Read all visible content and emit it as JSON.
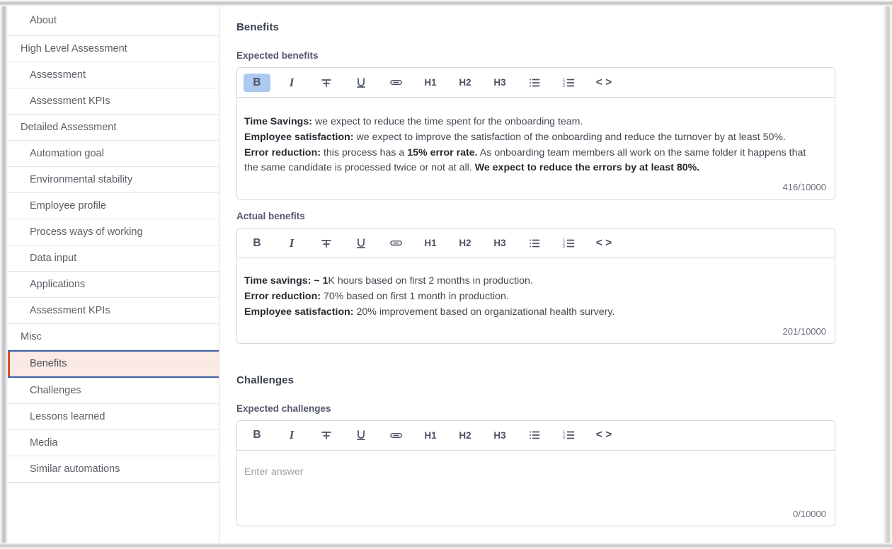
{
  "sidebar": {
    "items": [
      {
        "label": "About",
        "level": 1,
        "selected": false
      },
      {
        "label": "High Level Assessment",
        "level": 0,
        "selected": false
      },
      {
        "label": "Assessment",
        "level": 1,
        "selected": false
      },
      {
        "label": "Assessment KPIs",
        "level": 1,
        "selected": false
      },
      {
        "label": "Detailed Assessment",
        "level": 0,
        "selected": false
      },
      {
        "label": "Automation goal",
        "level": 1,
        "selected": false
      },
      {
        "label": "Environmental stability",
        "level": 1,
        "selected": false
      },
      {
        "label": "Employee profile",
        "level": 1,
        "selected": false
      },
      {
        "label": "Process ways of working",
        "level": 1,
        "selected": false
      },
      {
        "label": "Data input",
        "level": 1,
        "selected": false
      },
      {
        "label": "Applications",
        "level": 1,
        "selected": false
      },
      {
        "label": "Assessment KPIs",
        "level": 1,
        "selected": false
      },
      {
        "label": "Misc",
        "level": 0,
        "selected": false
      },
      {
        "label": "Benefits",
        "level": 1,
        "selected": true
      },
      {
        "label": "Challenges",
        "level": 1,
        "selected": false
      },
      {
        "label": "Lessons learned",
        "level": 1,
        "selected": false
      },
      {
        "label": "Media",
        "level": 1,
        "selected": false
      },
      {
        "label": "Similar automations",
        "level": 1,
        "selected": false
      }
    ]
  },
  "toolbar": {
    "bold": "B",
    "italic": "I",
    "strikethrough": "strikethrough-icon",
    "underline": "U",
    "link": "link-icon",
    "h1": "H1",
    "h2": "H2",
    "h3": "H3",
    "bullet_list": "bullet-list-icon",
    "numbered_list": "numbered-list-icon",
    "code": "< >"
  },
  "sections": {
    "benefits": {
      "title": "Benefits",
      "expected": {
        "label": "Expected benefits",
        "counter": "416/10000",
        "lines": [
          {
            "bold": "Time Savings:",
            "rest": " we expect to reduce the time spent for the onboarding team."
          },
          {
            "bold": "Employee satisfaction:",
            "rest": " we expect to improve the satisfaction of the onboarding and reduce the turnover by at least 50%."
          }
        ],
        "error_line": {
          "bold_lead": "Error reduction:",
          "part1": " this process has a ",
          "bold_mid": "15% error rate.",
          "part2": " As onboarding team members all work on the same folder it happens that the same candidate is processed twice or not at all. ",
          "bold_tail": "We expect to reduce the errors by at least 80%."
        }
      },
      "actual": {
        "label": "Actual benefits",
        "counter": "201/10000",
        "lines": [
          {
            "bold": "Time savings: ~ 1",
            "rest": "K hours based on first 2 months in production."
          },
          {
            "bold": "Error reduction:",
            "rest": " 70% based on first 1 month in production."
          },
          {
            "bold": "Employee satisfaction:",
            "rest": " 20% improvement based on organizational health survery."
          }
        ]
      }
    },
    "challenges": {
      "title": "Challenges",
      "expected": {
        "label": "Expected challenges",
        "placeholder": "Enter answer",
        "counter": "0/10000"
      }
    }
  }
}
